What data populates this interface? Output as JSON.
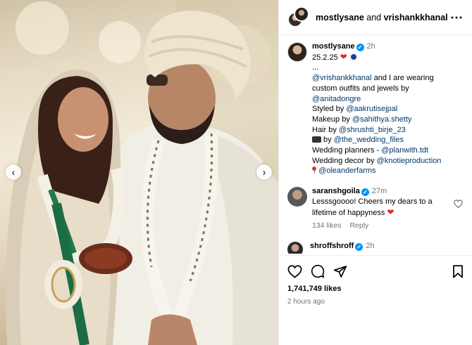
{
  "header": {
    "user1": "mostlysane",
    "conjunction": "and",
    "user2": "vrishankkhanal",
    "more_icon": "more-horizontal-icon"
  },
  "media": {
    "prev_icon": "‹",
    "next_icon": "›"
  },
  "caption": {
    "username": "mostlysane",
    "time": "2h",
    "date_line": "25.2.25",
    "ellipsis": "...",
    "mention_vrishank": "@vrishankkhanal",
    "line1_rest": " and I are wearing",
    "line2": "custom outfits and jewels by",
    "mention_anita": "@anitadongre",
    "styled_prefix": "Styled by ",
    "mention_styled": "@aakrutisejpal",
    "makeup_prefix": "Makeup by ",
    "mention_makeup": "@sahithya.shetty",
    "hair_prefix": "Hair by ",
    "mention_hair": "@shrushti_birje_23",
    "camera_by": " by ",
    "mention_camera": "@the_wedding_files",
    "planners_prefix": "Wedding planners - ",
    "mention_planners": "@planwith.tdt",
    "decor_prefix": "Wedding decor by ",
    "mention_decor": "@knotieproduction",
    "mention_location": "@oleanderfarms"
  },
  "comments": [
    {
      "username": "saranshgoila",
      "time": "27m",
      "text": "Lesssgoooo! Cheers my dears to a lifetime of happyness",
      "likes": "134 likes",
      "reply": "Reply"
    },
    {
      "username": "shroffshroff",
      "time": "2h"
    }
  ],
  "actions": {
    "likes_count": "1,741,749 likes",
    "posted": "2 hours ago"
  },
  "colors": {
    "verified": "#0095f6",
    "mention": "#00376b",
    "heart": "#e2263a",
    "muted": "#737373"
  }
}
